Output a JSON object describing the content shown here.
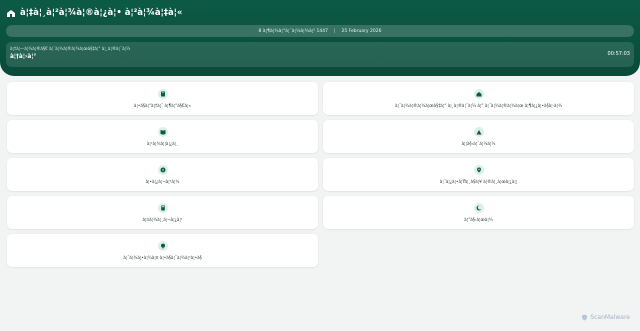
{
  "header": {
    "app_title": "à¦‡à¦¸à¦²à¦¾à¦®à¦¿à¦• à¦²à¦¾à¦‡à¦«",
    "hijri_date": "8 à¦¶à¦¾à¦“à¦¯à¦¼à¦¾à¦² 1447",
    "separator": "|",
    "gregorian_date": "25 February 2026",
    "prayer_label": "à¦†à¦—à¦¾à¦®à§€ à¦¨à¦¾à¦®à¦¾à¦œà§‡à¦° à¦¸à¦®à¦¯à¦¼",
    "prayer_name": "à¦†à¦›à¦°",
    "prayer_countdown": "00:57:03"
  },
  "menu": {
    "items": [
      {
        "label": "à¦•à§à¦°à¦†à¦¨ à¦¶à¦°à§€à¦«",
        "icon": "quran-icon"
      },
      {
        "label": "à¦¨à¦¾à¦®à¦¾à¦œà§‡à¦° à¦¸à¦®à¦¯à¦¼ à¦“ à¦¨à¦¾à¦®à¦¾à¦œ à¦¶à¦¿à¦•à§à¦·à¦¾",
        "icon": "mosque-icon"
      },
      {
        "label": "à¦¹à¦¾à¦¦à¦¿à¦¸",
        "icon": "book-icon"
      },
      {
        "label": "à¦¦à§‹à¦¯à¦¼à¦¾",
        "icon": "mountain-icon"
      },
      {
        "label": "à¦•à¦¿à¦¬à¦²à¦¾",
        "icon": "compass-icon"
      },
      {
        "label": "à¦¨à¦¿à¦•à¦Ÿà¦¸à§à¦¥ à¦®à¦¸à¦œà¦¿à¦¦",
        "icon": "location-pin-icon"
      },
      {
        "label": "à¦¤à¦¾à¦¸à¦¬à¦¿à¦¹",
        "icon": "counter-icon"
      },
      {
        "label": "à¦°à§‹à¦œà¦¾",
        "icon": "crescent-icon"
      },
      {
        "label": "à¦¯à¦¾à¦•à¦¾à¦¤ à¦•à§à¦¯à¦¾à¦²à¦•à§",
        "icon": "zakat-icon"
      }
    ]
  },
  "watermark": {
    "text": "ScanMalware"
  },
  "colors": {
    "primary": "#0c5a45",
    "icon_bg": "#dcefe8",
    "icon_fg": "#0c5a45",
    "background": "#f2f4f3"
  }
}
